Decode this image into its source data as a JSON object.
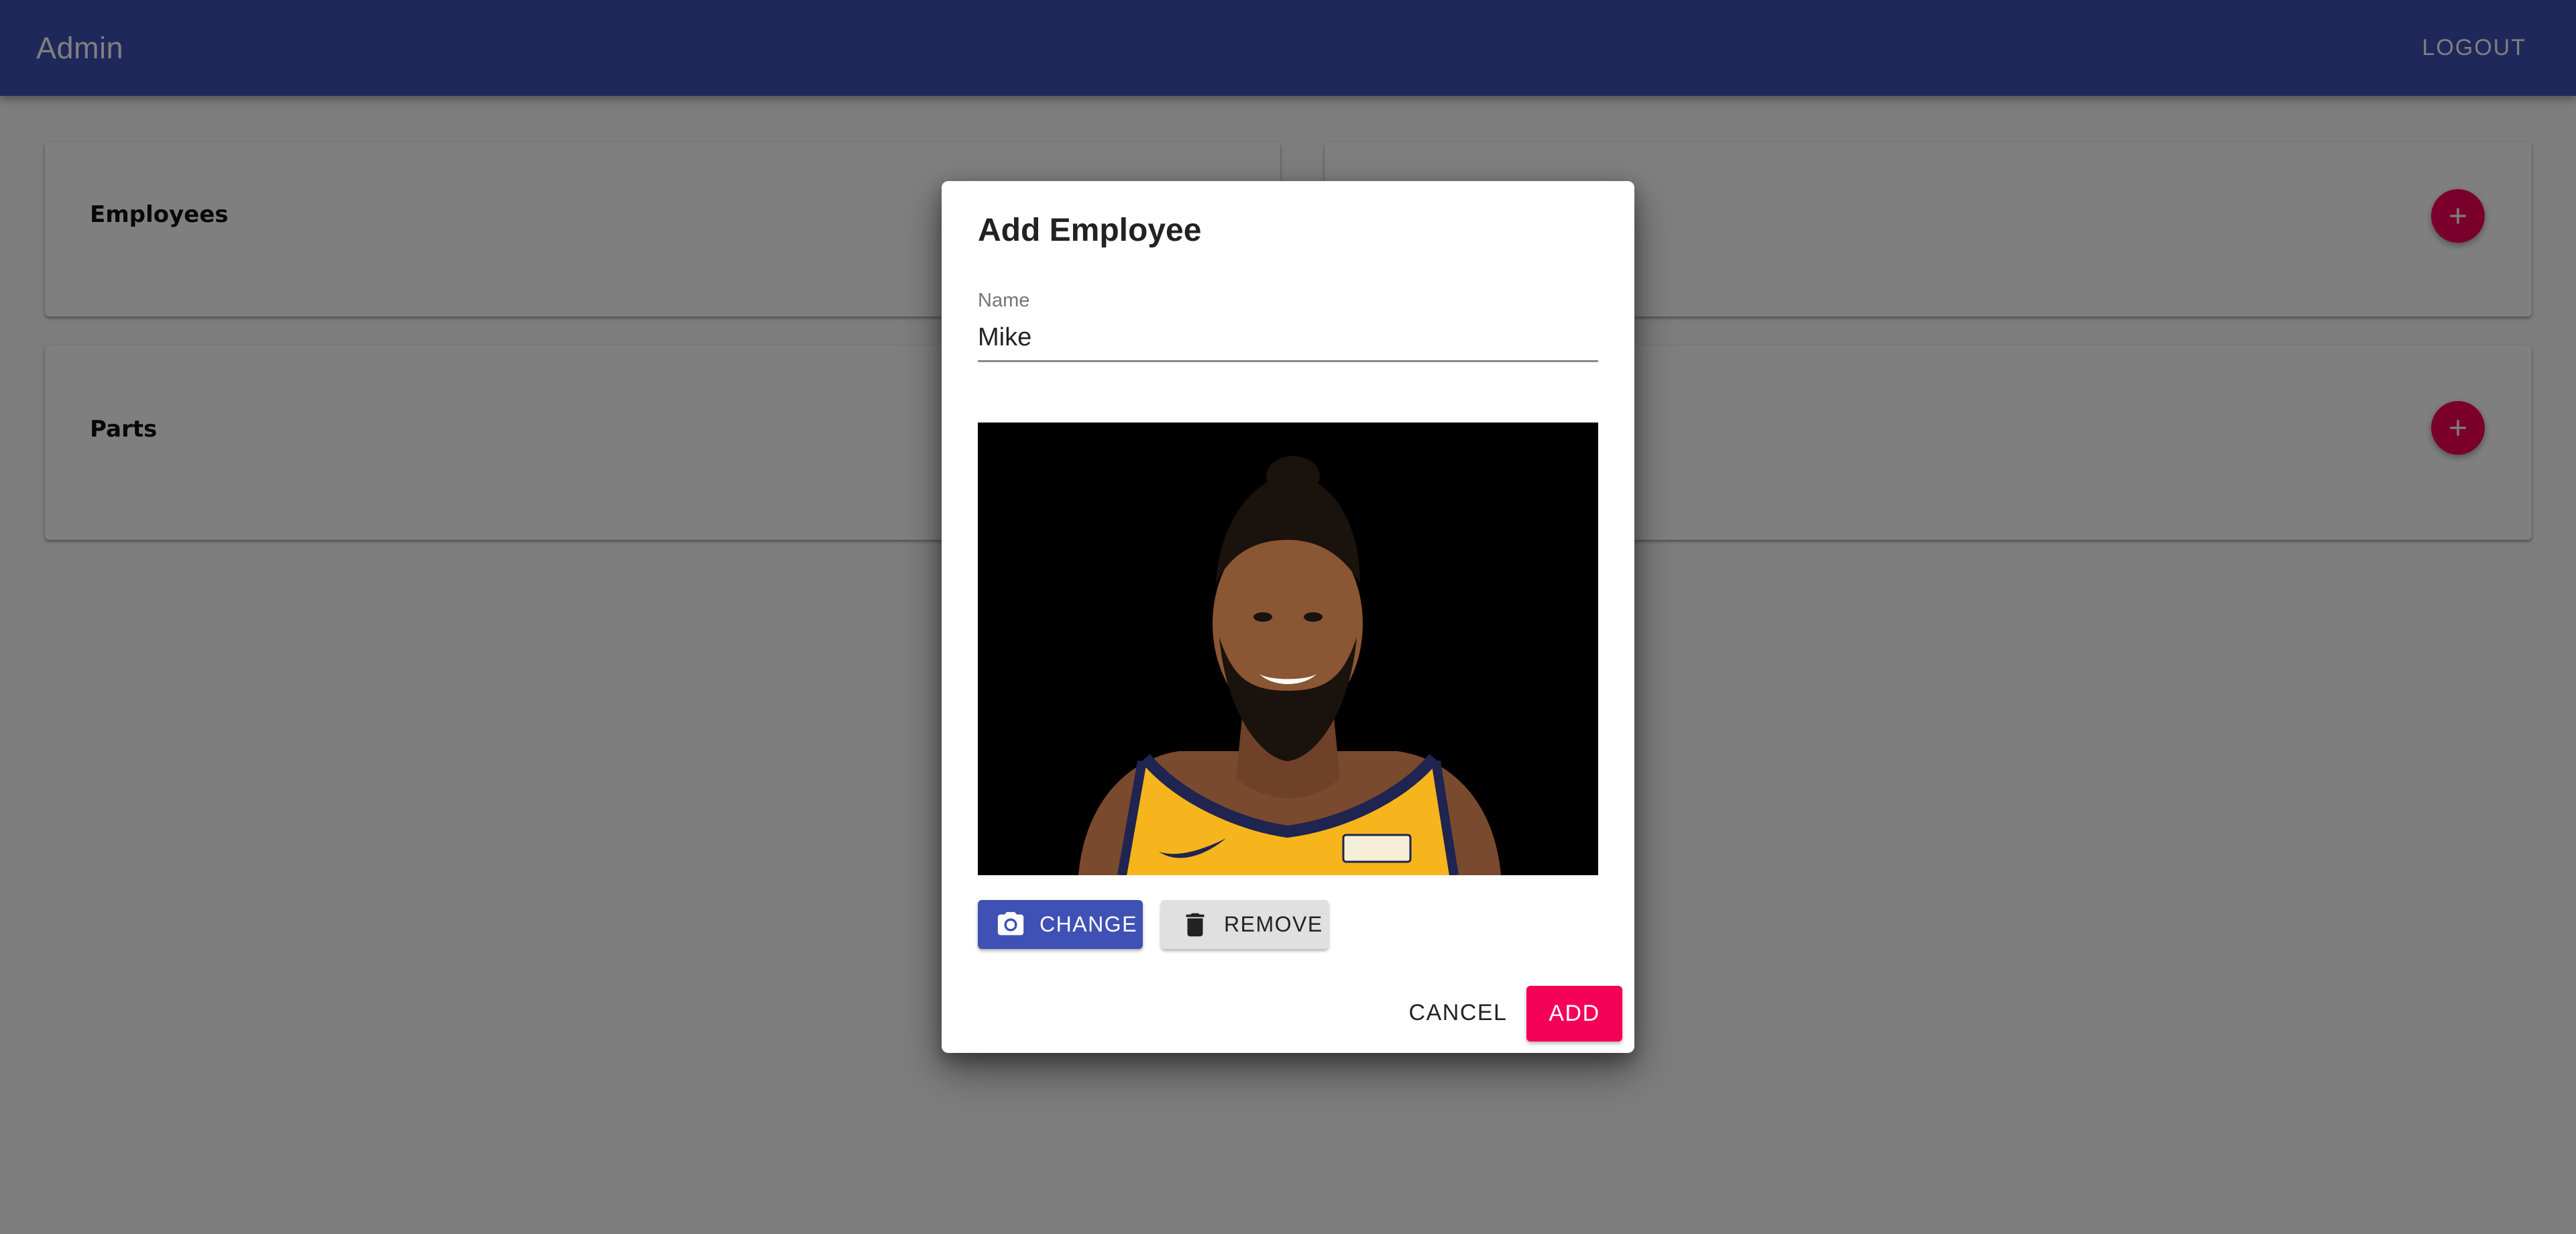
{
  "app": {
    "title": "Admin",
    "logout_label": "LOGOUT"
  },
  "cards": [
    {
      "title": "Employees",
      "add_icon": "plus-icon"
    },
    {
      "title": "Parts",
      "add_icon": "plus-icon"
    }
  ],
  "dialog": {
    "title": "Add Employee",
    "name_field": {
      "label": "Name",
      "value": "Mike"
    },
    "photo": {
      "description_icon": "employee-photo"
    },
    "change_label": "CHANGE",
    "change_icon": "camera-icon",
    "remove_label": "REMOVE",
    "remove_icon": "trash-icon",
    "cancel_label": "CANCEL",
    "add_label": "ADD"
  },
  "colors": {
    "primary": "#3f51b5",
    "accent": "#f50057",
    "scrim": "rgba(0,0,0,0.5)"
  }
}
